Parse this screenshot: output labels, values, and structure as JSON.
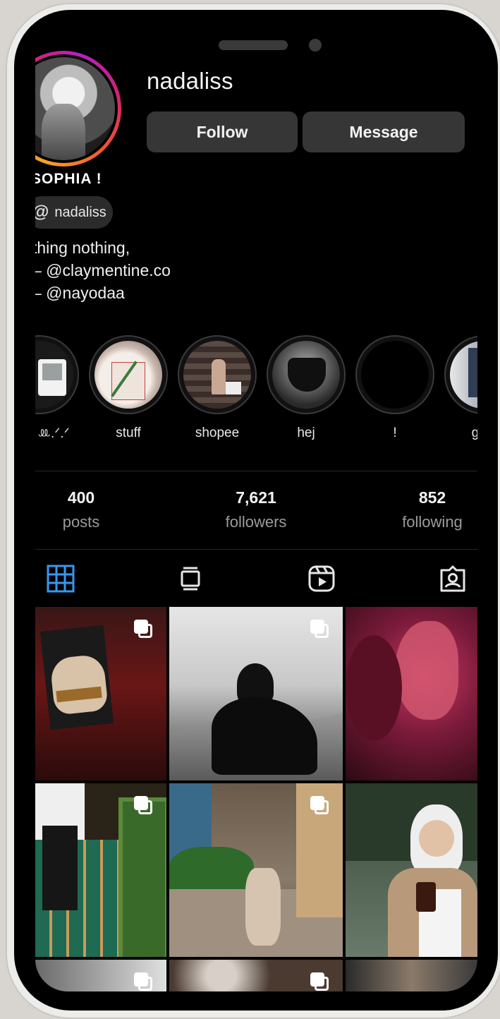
{
  "profile": {
    "username": "nadaliss",
    "display_name": "SOPHIA !",
    "threads_handle": "nadaliss",
    "threads_icon": "threads-icon",
    "follow_label": "Follow",
    "message_label": "Message",
    "bio": [
      "thing nothing,",
      "– @claymentine.co",
      "– @nayodaa"
    ]
  },
  "highlights": [
    {
      "label": "ꔛ.ᐟ.ᐟ"
    },
    {
      "label": "stuff"
    },
    {
      "label": "shopee"
    },
    {
      "label": "hej"
    },
    {
      "label": "!"
    },
    {
      "label": "gi"
    }
  ],
  "stats": {
    "posts": {
      "value": "400",
      "label": "posts"
    },
    "followers": {
      "value": "7,621",
      "label": "followers"
    },
    "following": {
      "value": "852",
      "label": "following"
    }
  },
  "tabs": [
    {
      "icon": "grid-icon",
      "active": true
    },
    {
      "icon": "feed-icon",
      "active": false
    },
    {
      "icon": "reels-icon",
      "active": false
    },
    {
      "icon": "tagged-icon",
      "active": false
    }
  ],
  "colors": {
    "accent": "#3797f0",
    "ring_start": "#f9a326",
    "ring_end": "#b61fc2",
    "button_bg": "#363636"
  }
}
